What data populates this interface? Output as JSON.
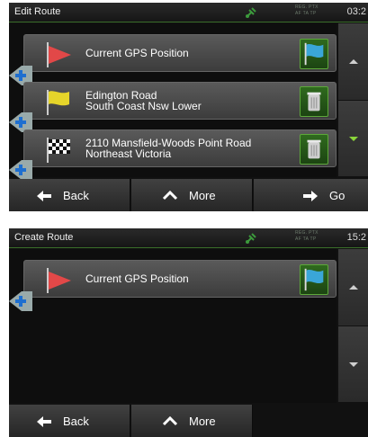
{
  "screen1": {
    "title": "Edit Route",
    "status_text": "REG. PTX\nAF TA TP",
    "clock": "03:2",
    "items": [
      {
        "label": "Current GPS Position",
        "icon": "red-flag-icon",
        "action": "blue-flag-icon"
      },
      {
        "label": "Edington Road\nSouth Coast Nsw Lower",
        "icon": "yellow-flag-icon",
        "action": "trash-icon"
      },
      {
        "label": "2110 Mansfield-Woods Point Road\nNortheast Victoria",
        "icon": "checkered-flag-icon",
        "action": "trash-icon"
      }
    ],
    "buttons": {
      "back": "Back",
      "more": "More",
      "go": "Go"
    }
  },
  "screen2": {
    "title": "Create Route",
    "status_text": "REG. PTX\nAF TA TP",
    "clock": "15:2",
    "items": [
      {
        "label": "Current GPS Position",
        "icon": "red-flag-icon",
        "action": "blue-flag-icon"
      }
    ],
    "buttons": {
      "back": "Back",
      "more": "More"
    }
  },
  "colors": {
    "accent_green": "#8ad43a",
    "bar_green": "#3a6e2a",
    "background": "#111111"
  }
}
